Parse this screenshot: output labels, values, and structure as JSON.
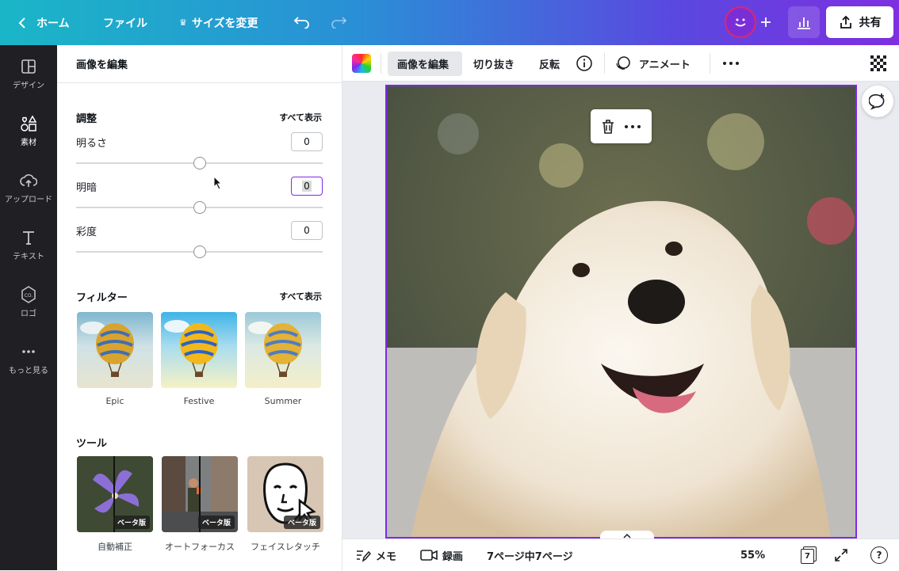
{
  "topbar": {
    "home_label": "ホーム",
    "file_label": "ファイル",
    "resize_label": "サイズを変更",
    "share_label": "共有",
    "colors": {
      "gradient_start": "#1ab6c7",
      "gradient_end": "#7e2fe0",
      "avatar_ring": "#e0266b"
    }
  },
  "rail": {
    "items": [
      {
        "label": "デザイン",
        "icon": "layout-icon"
      },
      {
        "label": "素材",
        "icon": "elements-icon"
      },
      {
        "label": "アップロード",
        "icon": "cloud-upload-icon"
      },
      {
        "label": "テキスト",
        "icon": "text-icon"
      },
      {
        "label": "ロゴ",
        "icon": "logo-icon"
      },
      {
        "label": "もっと見る",
        "icon": "more-icon"
      }
    ]
  },
  "panel": {
    "title": "画像を編集",
    "adjust": {
      "title": "調整",
      "show_all": "すべて表示",
      "sliders": [
        {
          "label": "明るさ",
          "value": "0",
          "level": 0.5
        },
        {
          "label": "明暗",
          "value": "0",
          "level": 0.5
        },
        {
          "label": "彩度",
          "value": "0",
          "level": 0.5
        }
      ]
    },
    "filters": {
      "title": "フィルター",
      "show_all": "すべて表示",
      "items": [
        {
          "label": "Epic"
        },
        {
          "label": "Festive"
        },
        {
          "label": "Summer"
        }
      ]
    },
    "tools": {
      "title": "ツール",
      "items": [
        {
          "label": "自動補正",
          "badge": "ベータ版"
        },
        {
          "label": "オートフォーカス",
          "badge": "ベータ版"
        },
        {
          "label": "フェイスレタッチ",
          "badge": "ベータ版"
        }
      ]
    }
  },
  "context_toolbar": {
    "edit_image": "画像を編集",
    "crop": "切り抜き",
    "flip": "反転",
    "animate": "アニメート"
  },
  "bottombar": {
    "notes": "メモ",
    "record": "録画",
    "pages": "7ページ中7ページ",
    "zoom": "55%",
    "page_count": "7",
    "help": "?"
  }
}
